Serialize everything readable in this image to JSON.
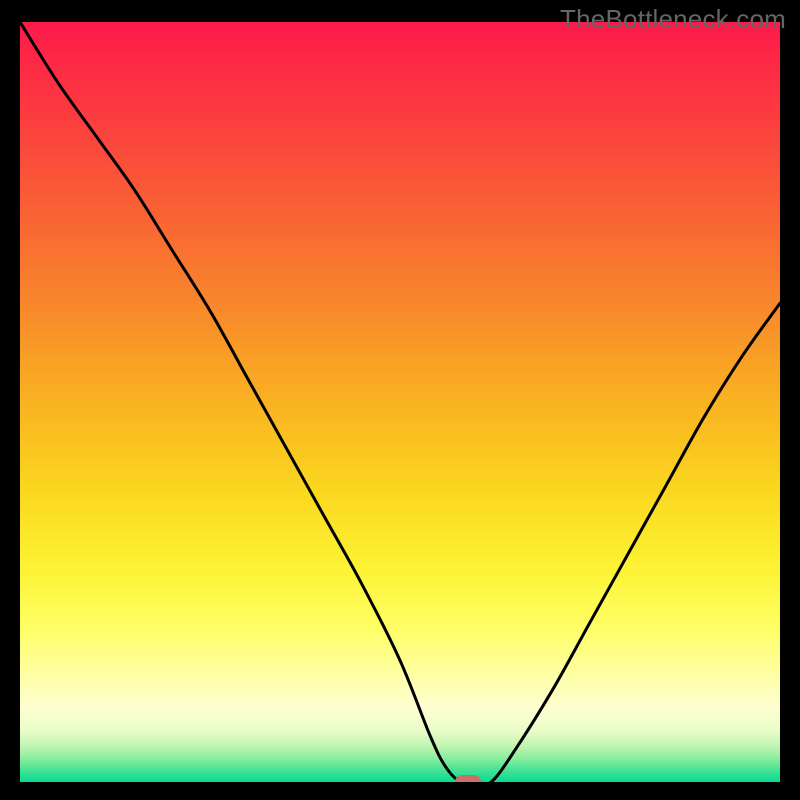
{
  "watermark": {
    "text": "TheBottleneck.com"
  },
  "colors": {
    "frame_bg": "#000000",
    "curve": "#000000",
    "marker": "#c9706d",
    "watermark": "#666666"
  },
  "chart_data": {
    "type": "line",
    "title": "",
    "xlabel": "",
    "ylabel": "",
    "xlim": [
      0,
      100
    ],
    "ylim": [
      0,
      100
    ],
    "grid": false,
    "legend": false,
    "series": [
      {
        "name": "bottleneck-curve",
        "x": [
          0,
          5,
          10,
          15,
          20,
          25,
          30,
          35,
          40,
          45,
          50,
          54,
          56,
          58,
          60,
          62,
          65,
          70,
          75,
          80,
          85,
          90,
          95,
          100
        ],
        "y": [
          100,
          92,
          85,
          78,
          70,
          62,
          53,
          44,
          35,
          26,
          16,
          6,
          2,
          0,
          0,
          0,
          4,
          12,
          21,
          30,
          39,
          48,
          56,
          63
        ]
      }
    ],
    "marker": {
      "x": 59,
      "y": 0
    },
    "background_gradient": [
      {
        "stop": 0.0,
        "color": "#fd1a4a"
      },
      {
        "stop": 0.12,
        "color": "#fb3b3f"
      },
      {
        "stop": 0.25,
        "color": "#f96234"
      },
      {
        "stop": 0.38,
        "color": "#f88a2a"
      },
      {
        "stop": 0.5,
        "color": "#f9b222"
      },
      {
        "stop": 0.62,
        "color": "#fbd81f"
      },
      {
        "stop": 0.72,
        "color": "#fdf334"
      },
      {
        "stop": 0.8,
        "color": "#feff66"
      },
      {
        "stop": 0.86,
        "color": "#feffa3"
      },
      {
        "stop": 0.905,
        "color": "#fdffd3"
      },
      {
        "stop": 0.935,
        "color": "#e9fcc8"
      },
      {
        "stop": 0.955,
        "color": "#bef4b0"
      },
      {
        "stop": 0.972,
        "color": "#85eb9c"
      },
      {
        "stop": 0.986,
        "color": "#45e193"
      },
      {
        "stop": 1.0,
        "color": "#0ddc90"
      }
    ]
  }
}
